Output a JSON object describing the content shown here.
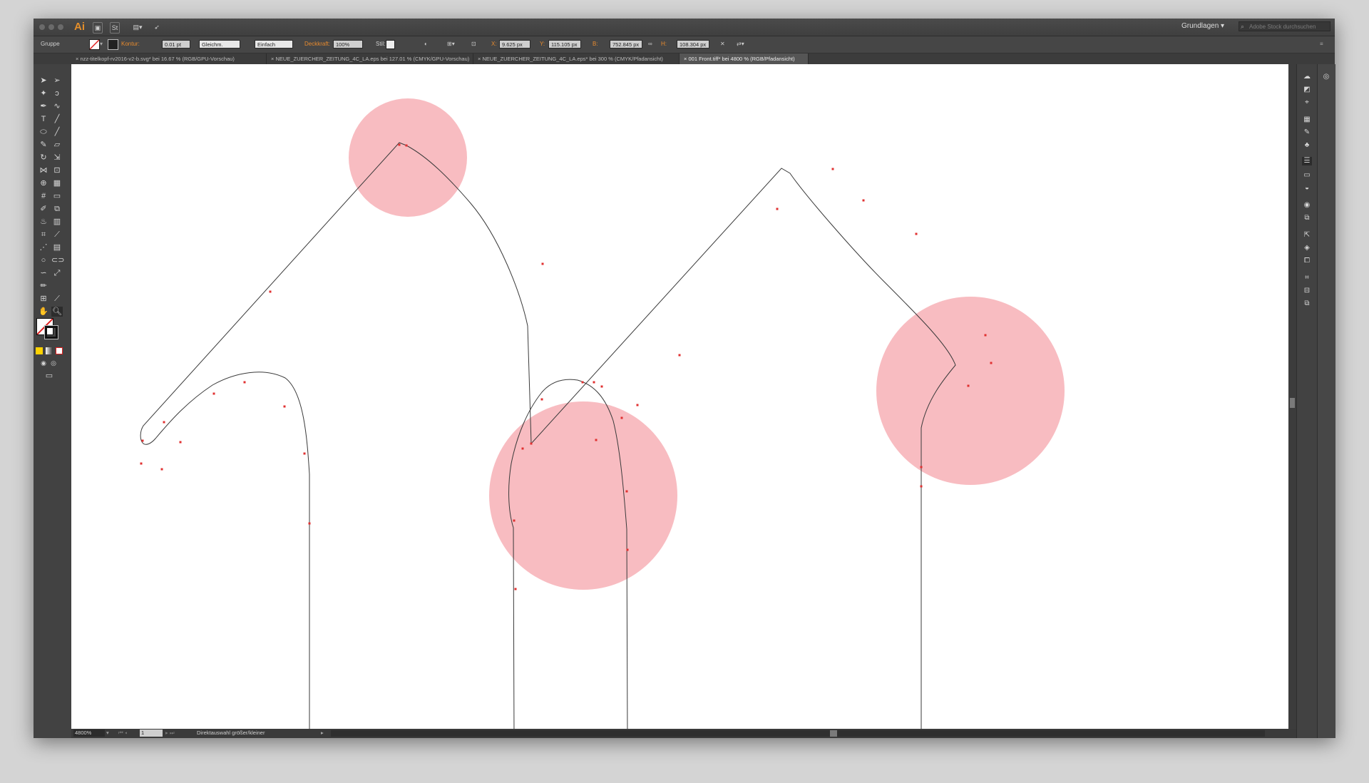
{
  "app": {
    "logo": "Ai",
    "workspace": "Grundlagen",
    "stock_search_placeholder": "Adobe Stock durchsuchen"
  },
  "controlbar": {
    "selection": "Gruppe",
    "stroke_label": "Kontur:",
    "stroke_weight": "0.01 pt",
    "profile": "Gleichm.",
    "brush": "Einfach",
    "opacity_label": "Deckkraft:",
    "opacity": "100%",
    "style_label": "Stil:",
    "x_label": "X:",
    "x": "9.625 px",
    "y_label": "Y:",
    "y": "115.105 px",
    "w_label": "B:",
    "w": "752.845 px",
    "h_label": "H:",
    "h": "108.304 px"
  },
  "tabs": [
    {
      "label": "nzz-titelkopf-rv2016-v2-b.svg* bei 16.67 % (RGB/GPU-Vorschau)",
      "active": false
    },
    {
      "label": "NEUE_ZUERCHER_ZEITUNG_4C_LA.eps bei 127.01 % (CMYK/GPU-Vorschau)",
      "active": false
    },
    {
      "label": "NEUE_ZUERCHER_ZEITUNG_4C_LA.eps* bei 300 % (CMYK/Pfadansicht)",
      "active": false
    },
    {
      "label": "001 Front.tiff* bei 4800 % (RGB/Pfadansicht)",
      "active": true
    }
  ],
  "tab_close": "×",
  "status": {
    "zoom": "4800%",
    "artboard": "1",
    "hint": "Direktauswahl größer/kleiner"
  },
  "colors": {
    "highlight_circle": "#f8bcc1",
    "path_stroke": "#3a3a3a",
    "anchor_point": "#e03030",
    "accent_label": "#e88b2e"
  }
}
